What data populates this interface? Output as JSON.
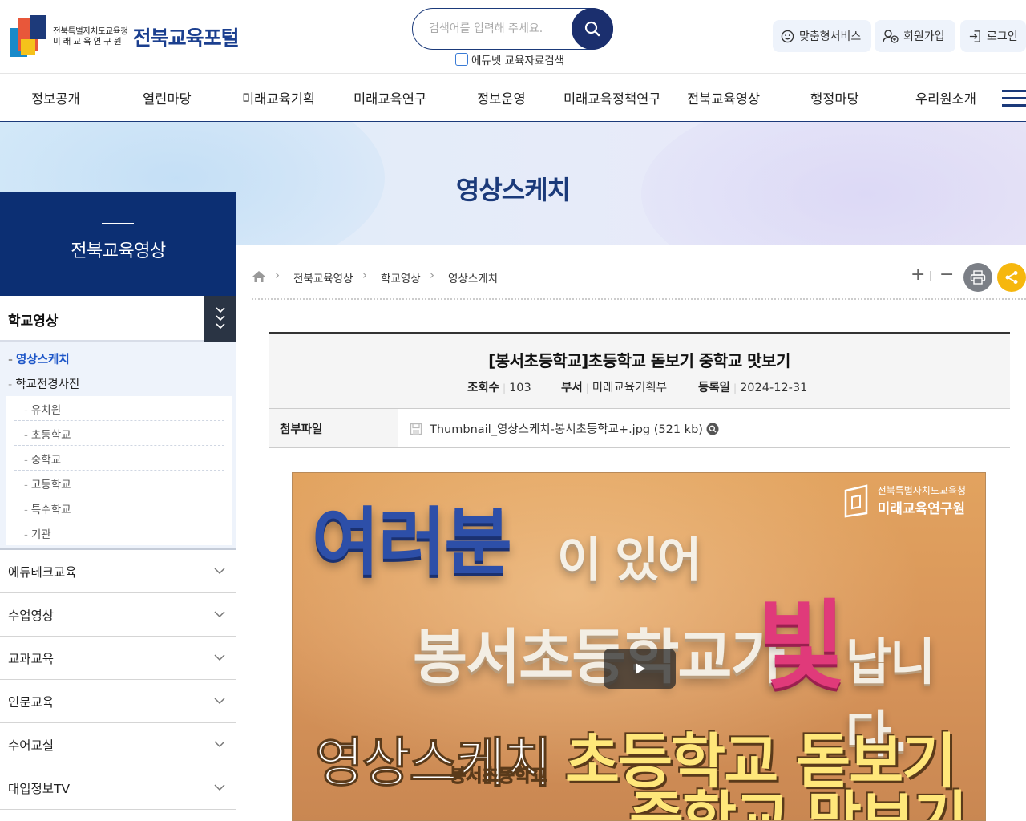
{
  "header": {
    "logo_org": "전북특별자치도교육청",
    "logo_inst": "미래교육연구원",
    "logo_title": "전북교육포털",
    "search_placeholder": "검색어를 입력해 주세요.",
    "search_option": "에듀넷 교육자료검색",
    "util": [
      {
        "label": "맞춤형서비스",
        "icon": "smile-icon"
      },
      {
        "label": "회원가입",
        "icon": "user-add-icon"
      },
      {
        "label": "로그인",
        "icon": "login-icon"
      }
    ]
  },
  "gnb": [
    "정보공개",
    "열린마당",
    "미래교육기획",
    "미래교육연구",
    "정보운영",
    "미래교육정책연구",
    "전북교육영상",
    "행정마당",
    "우리원소개"
  ],
  "visual": {
    "title": "영상스케치"
  },
  "sidebar": {
    "title": "전북교육영상",
    "selected": "학교영상",
    "sub_items": [
      {
        "label": "영상스케치",
        "active": true
      },
      {
        "label": "학교전경사진",
        "active": false
      }
    ],
    "sub2_items": [
      "유치원",
      "초등학교",
      "중학교",
      "고등학교",
      "특수학교",
      "기관"
    ],
    "menus": [
      "에듀테크교육",
      "수업영상",
      "교과교육",
      "인문교육",
      "수어교실",
      "대입정보TV"
    ]
  },
  "breadcrumb": [
    "전북교육영상",
    "학교영상",
    "영상스케치"
  ],
  "zoom": {
    "plus": "+",
    "minus": "−"
  },
  "post": {
    "title": "[봉서초등학교]초등학교 돋보기 중학교 맛보기",
    "views_label": "조회수",
    "views": "103",
    "dept_label": "부서",
    "dept": "미래교육기획부",
    "date_label": "등록일",
    "date": "2024-12-31",
    "attach_label": "첨부파일",
    "attach_file": "Thumbnail_영상스케치-봉서초등학교+.jpg (521 kb)"
  },
  "video": {
    "line1a": "여러분",
    "line1b": "이 있어",
    "line2": "봉서초등학교가",
    "line2_bit": "빛",
    "line2_end": "납니다.",
    "sub_title": "영상스케치",
    "sub_school": "봉서초등학교",
    "line4": "초등학교 돋보기",
    "line5": "중학교 맛보기",
    "logo_org": "전북특별자치도교육청",
    "logo_inst": "미래교육연구원"
  },
  "colors": {
    "primary": "#0c2f73",
    "accent": "#1d56c8",
    "share": "#f6b70e"
  }
}
